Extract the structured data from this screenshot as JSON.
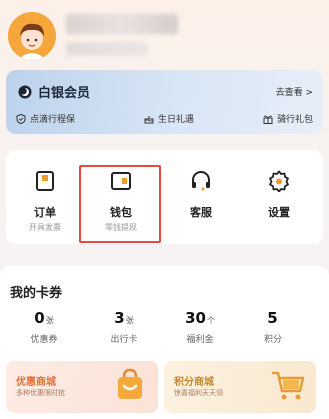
{
  "member": {
    "title": "白银会员",
    "more": "去查看 >",
    "perks": [
      "点滴行程保",
      "生日礼遇",
      "骑行礼包"
    ]
  },
  "grid": [
    {
      "label": "订单",
      "sub": "开具发票"
    },
    {
      "label": "钱包",
      "sub": "零钱提现"
    },
    {
      "label": "客服",
      "sub": ""
    },
    {
      "label": "设置",
      "sub": ""
    }
  ],
  "cards": {
    "title": "我的卡券",
    "stats": [
      {
        "value": "0",
        "unit": "张",
        "label": "优惠券"
      },
      {
        "value": "3",
        "unit": "张",
        "label": "出行卡"
      },
      {
        "value": "30",
        "unit": "个",
        "label": "福利金"
      },
      {
        "value": "5",
        "unit": "",
        "label": "积分"
      }
    ],
    "promos": [
      {
        "title": "优惠商城",
        "sub": "多种优惠限时抢"
      },
      {
        "title": "积分商城",
        "sub": "惊喜福利天天领"
      }
    ]
  },
  "colors": {
    "accent_red": "#e64a3c",
    "member_blue": "#bcd2ec",
    "promo_orange": "#e0703f",
    "promo_gold": "#c58a2f"
  }
}
